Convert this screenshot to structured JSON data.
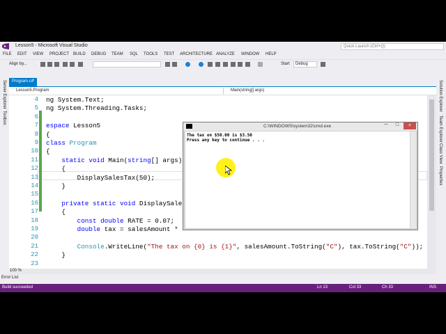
{
  "app": {
    "title": "Lesson5 - Microsoft Visual Studio",
    "quick_launch_placeholder": "Quick Launch (Ctrl+Q)"
  },
  "menu": [
    "FILE",
    "EDIT",
    "VIEW",
    "PROJECT",
    "BUILD",
    "DEBUG",
    "TEAM",
    "SQL",
    "TOOLS",
    "TEST",
    "ARCHITECTURE",
    "ANALYZE",
    "WINDOW",
    "HELP"
  ],
  "toolbar": {
    "align_label": "Align by...",
    "start_label": "Start",
    "config_value": "Debug"
  },
  "left_panels": {
    "server_explorer": "Server Explorer",
    "toolbox": "Toolbox"
  },
  "right_panels": {
    "solution_explorer": "Solution Explorer",
    "team_explorer": "Team Explorer",
    "class_view": "Class View",
    "properties": "Properties"
  },
  "doc_tab": {
    "name": "Program.cs",
    "close": "×"
  },
  "navbar": {
    "left": "Lesson5.Program",
    "right": "Main(string[] args)"
  },
  "editor": {
    "zoom": "100 %",
    "lines": [
      {
        "num": "4",
        "parts": [
          {
            "t": "ng System.Text;",
            "c": ""
          }
        ]
      },
      {
        "num": "5",
        "parts": [
          {
            "t": "ng System.Threading.Tasks;",
            "c": ""
          }
        ]
      },
      {
        "num": "6",
        "parts": []
      },
      {
        "num": "7",
        "parts": [
          {
            "t": "espace ",
            "c": "kw"
          },
          {
            "t": "Lesson5",
            "c": ""
          }
        ]
      },
      {
        "num": "8",
        "parts": [
          {
            "t": "{",
            "c": ""
          }
        ]
      },
      {
        "num": "9",
        "parts": [
          {
            "t": "class ",
            "c": "kw"
          },
          {
            "t": "Program",
            "c": "ty"
          }
        ]
      },
      {
        "num": "10",
        "parts": [
          {
            "t": "{",
            "c": ""
          }
        ]
      },
      {
        "num": "11",
        "parts": [
          {
            "t": "    static void ",
            "c": "kw"
          },
          {
            "t": "Main(",
            "c": ""
          },
          {
            "t": "string",
            "c": "kw"
          },
          {
            "t": "[] args)",
            "c": ""
          }
        ]
      },
      {
        "num": "12",
        "parts": [
          {
            "t": "    {",
            "c": ""
          }
        ]
      },
      {
        "num": "13",
        "parts": [
          {
            "t": "        DisplaySalesTax(50);",
            "c": ""
          }
        ]
      },
      {
        "num": "14",
        "parts": [
          {
            "t": "    }",
            "c": ""
          }
        ]
      },
      {
        "num": "15",
        "parts": []
      },
      {
        "num": "16",
        "parts": [
          {
            "t": "    private static void ",
            "c": "kw"
          },
          {
            "t": "DisplaySale",
            "c": ""
          }
        ]
      },
      {
        "num": "17",
        "parts": [
          {
            "t": "    {",
            "c": ""
          }
        ]
      },
      {
        "num": "18",
        "parts": [
          {
            "t": "        const double ",
            "c": "kw"
          },
          {
            "t": "RATE = 0.07;",
            "c": ""
          }
        ]
      },
      {
        "num": "19",
        "parts": [
          {
            "t": "        double ",
            "c": "kw"
          },
          {
            "t": "tax = salesAmount *",
            "c": ""
          }
        ]
      },
      {
        "num": "20",
        "parts": []
      },
      {
        "num": "21",
        "parts": [
          {
            "t": "        ",
            "c": ""
          },
          {
            "t": "Console",
            "c": "ty"
          },
          {
            "t": ".WriteLine(",
            "c": ""
          },
          {
            "t": "\"The tax on {0} is {1}\"",
            "c": "st"
          },
          {
            "t": ", salesAmount.ToString(",
            "c": ""
          },
          {
            "t": "\"C\"",
            "c": "st"
          },
          {
            "t": "), tax.ToString(",
            "c": ""
          },
          {
            "t": "\"C\"",
            "c": "st"
          },
          {
            "t": "));",
            "c": ""
          }
        ]
      },
      {
        "num": "22",
        "parts": [
          {
            "t": "    }",
            "c": ""
          }
        ]
      },
      {
        "num": "23",
        "parts": []
      }
    ]
  },
  "error_list": "Error List",
  "status": {
    "message": "Build succeeded",
    "ln": "Ln 13",
    "col": "Col 33",
    "ch": "Ch 33",
    "mode": "INS"
  },
  "cmd": {
    "title": "C:\\WINDOWS\\system32\\cmd.exe",
    "minimize": "─",
    "maximize": "□",
    "close": "×",
    "output": [
      "The tax on $50.00 is $3.50",
      "Press any key to continue . . ."
    ]
  },
  "colors": {
    "accent": "#007acc",
    "status_bar": "#68217a",
    "keyword": "#0000ff",
    "type": "#2b91af",
    "string": "#a31515"
  }
}
